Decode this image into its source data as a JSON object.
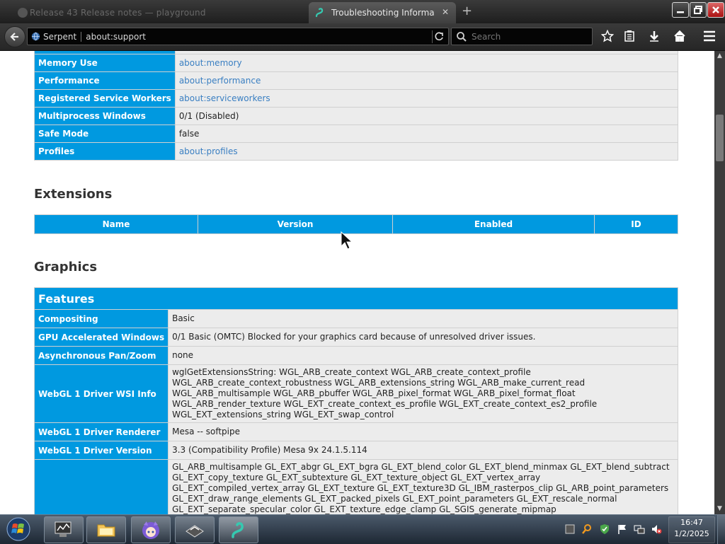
{
  "tabs": [
    {
      "label": "Release 43 Release notes — playground"
    },
    {
      "label": "Troubleshooting Information"
    }
  ],
  "browser": {
    "identity": "Serpent",
    "url": "about:support",
    "search_placeholder": "Search"
  },
  "top_rows": [
    {
      "name": "Memory Use",
      "value": "about:memory"
    },
    {
      "name": "Performance",
      "value": "about:performance"
    },
    {
      "name": "Registered Service Workers",
      "value": "about:serviceworkers"
    },
    {
      "name": "Multiprocess Windows",
      "value": "0/1 (Disabled)"
    },
    {
      "name": "Safe Mode",
      "value": "false"
    },
    {
      "name": "Profiles",
      "value": "about:profiles"
    }
  ],
  "extensions": {
    "title": "Extensions",
    "columns": [
      "Name",
      "Version",
      "Enabled",
      "ID"
    ]
  },
  "graphics": {
    "title": "Graphics",
    "features_header": "Features",
    "rows": [
      {
        "name": "Compositing",
        "value": "Basic"
      },
      {
        "name": "GPU Accelerated Windows",
        "value": "0/1 Basic (OMTC) Blocked for your graphics card because of unresolved driver issues."
      },
      {
        "name": "Asynchronous Pan/Zoom",
        "value": "none"
      },
      {
        "name": "WebGL 1 Driver WSI Info",
        "value": "wglGetExtensionsString: WGL_ARB_create_context WGL_ARB_create_context_profile WGL_ARB_create_context_robustness WGL_ARB_extensions_string WGL_ARB_make_current_read WGL_ARB_multisample WGL_ARB_pbuffer WGL_ARB_pixel_format WGL_ARB_pixel_format_float WGL_ARB_render_texture WGL_EXT_create_context_es_profile WGL_EXT_create_context_es2_profile WGL_EXT_extensions_string WGL_EXT_swap_control"
      },
      {
        "name": "WebGL 1 Driver Renderer",
        "value": "Mesa -- softpipe"
      },
      {
        "name": "WebGL 1 Driver Version",
        "value": "3.3 (Compatibility Profile) Mesa 9x 24.1.5.114"
      },
      {
        "name": "",
        "value": "GL_ARB_multisample GL_EXT_abgr GL_EXT_bgra GL_EXT_blend_color GL_EXT_blend_minmax GL_EXT_blend_subtract GL_EXT_copy_texture GL_EXT_subtexture GL_EXT_texture_object GL_EXT_vertex_array GL_EXT_compiled_vertex_array GL_EXT_texture GL_EXT_texture3D GL_IBM_rasterpos_clip GL_ARB_point_parameters GL_EXT_draw_range_elements GL_EXT_packed_pixels GL_EXT_point_parameters GL_EXT_rescale_normal GL_EXT_separate_specular_color GL_EXT_texture_edge_clamp GL_SGIS_generate_mipmap GL_SGIS_texture_border_clamp GL_SGIS_texture_edge_clamp GL_SGIS_texture_lod GL_ARB_framebuffer_sRGB GL_ARB_multitexture GL_EXT_framebuffer_sRGB GL_IBM_multimode_draw_arrays GL_IBM_texture_mirrored_repeat"
      }
    ]
  },
  "taskbar": {
    "time": "16:47",
    "date": "1/2/2025"
  },
  "colors": {
    "accent": "#0099e0",
    "cell_bg": "#ececec",
    "link": "#3a7fc2"
  },
  "icons": [
    "serpent-tab-icon",
    "back-arrow-icon",
    "globe-icon",
    "reload-icon",
    "search-icon",
    "star-icon",
    "reading-list-icon",
    "download-icon",
    "home-icon",
    "menu-icon",
    "windows-start-icon"
  ]
}
